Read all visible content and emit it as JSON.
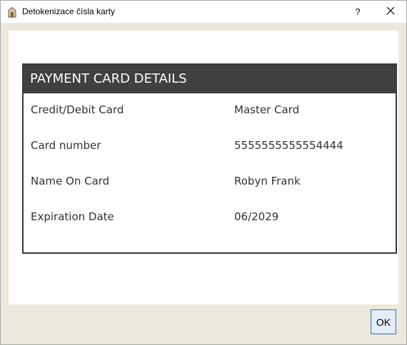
{
  "window": {
    "title": "Detokenizace čísla karty",
    "help_label": "?",
    "close_label": "✕"
  },
  "card": {
    "header": "PAYMENT CARD DETAILS",
    "rows": [
      {
        "label": "Credit/Debit Card",
        "value": "Master Card"
      },
      {
        "label": "Card number",
        "value": "5555555555554444"
      },
      {
        "label": "Name On Card",
        "value": "Robyn Frank"
      },
      {
        "label": "Expiration Date",
        "value": "06/2029"
      }
    ]
  },
  "footer": {
    "ok_label": "OK"
  },
  "colors": {
    "header_bg": "#404040",
    "header_text": "#ffffff",
    "dialog_bg": "#ece9dc",
    "ok_border": "#3d7bb5"
  }
}
